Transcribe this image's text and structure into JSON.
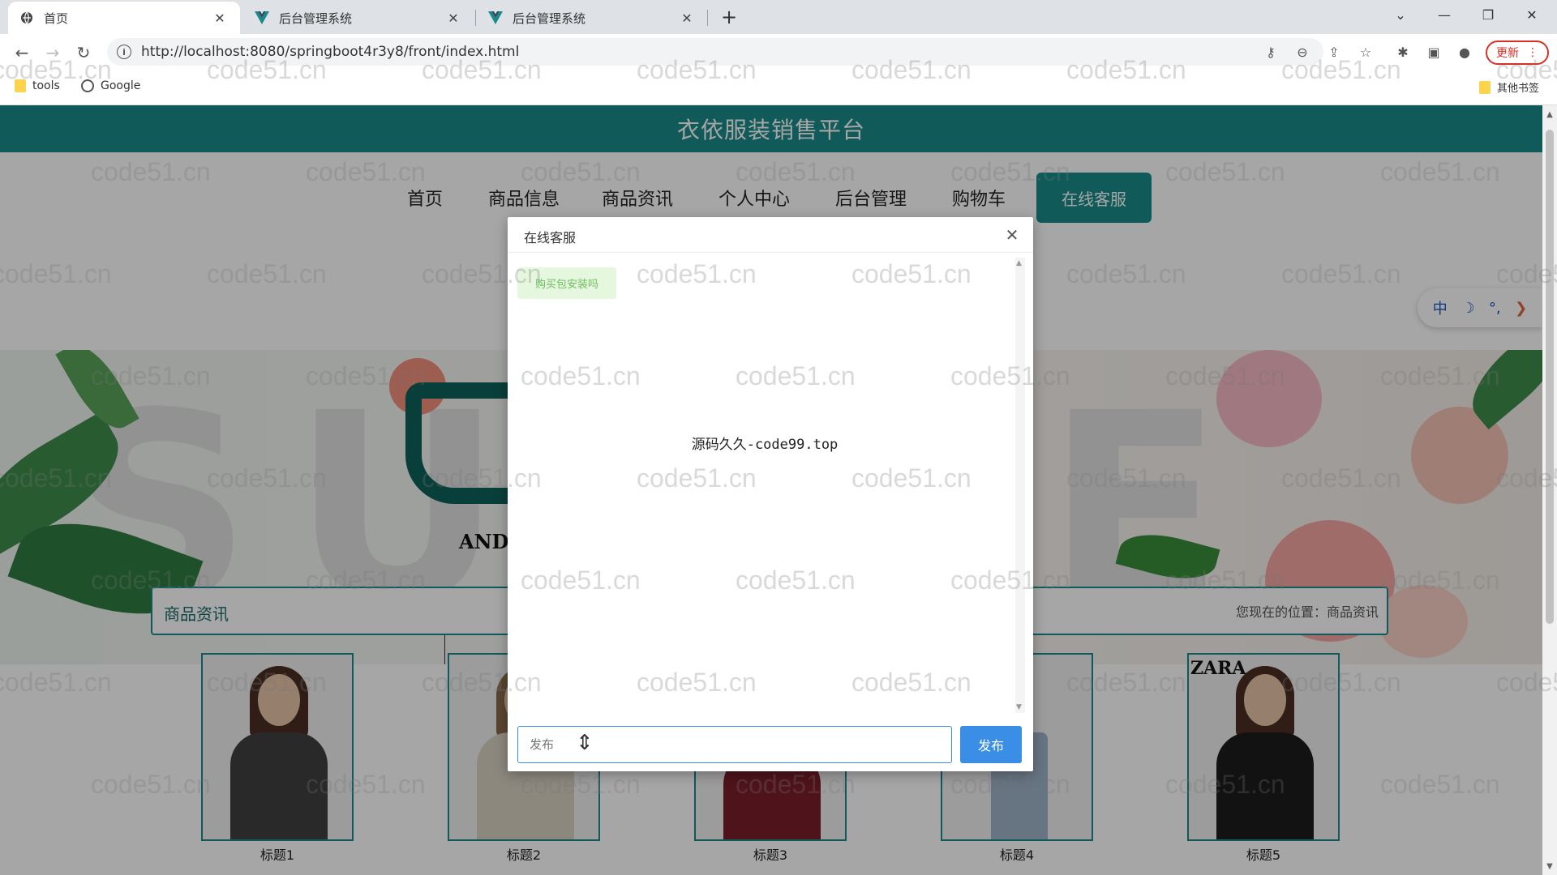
{
  "browser": {
    "tabs": [
      {
        "title": "首页",
        "active": true
      },
      {
        "title": "后台管理系统",
        "active": false
      },
      {
        "title": "后台管理系统",
        "active": false
      }
    ],
    "url": "http://localhost:8080/springboot4r3y8/front/index.html",
    "update_label": "更新",
    "bookmarks": [
      {
        "label": "tools",
        "icon": "folder-icon"
      },
      {
        "label": "Google",
        "icon": "globe-icon"
      }
    ],
    "other_bookmarks": "其他书签"
  },
  "site": {
    "title": "衣依服装销售平台",
    "nav": [
      "首页",
      "商品信息",
      "商品资讯",
      "个人中心",
      "后台管理",
      "购物车",
      "在线客服"
    ],
    "banner_text": "AND",
    "section_title": "商品资讯",
    "breadcrumb": "您现在的位置：商品资讯",
    "products": [
      {
        "label": "标题1"
      },
      {
        "label": "标题2"
      },
      {
        "label": "标题3"
      },
      {
        "label": "标题4"
      },
      {
        "label": "标题5"
      }
    ],
    "product_tag": "ZARA",
    "side_widget": {
      "lang": "中",
      "moon": "☽",
      "dots": "°,",
      "arrow": "❯"
    }
  },
  "dialog": {
    "title": "在线客服",
    "messages": [
      {
        "text": "购买包安装吗"
      }
    ],
    "center_watermark": "源码久久-code99.top",
    "input_placeholder": "发布",
    "send_label": "发布"
  },
  "watermark": "code51.cn",
  "colors": {
    "header": "#1a8a8a",
    "send_button": "#3a8ee6",
    "bubble_bg": "#e5f7de",
    "bubble_text": "#6cbf5b"
  }
}
